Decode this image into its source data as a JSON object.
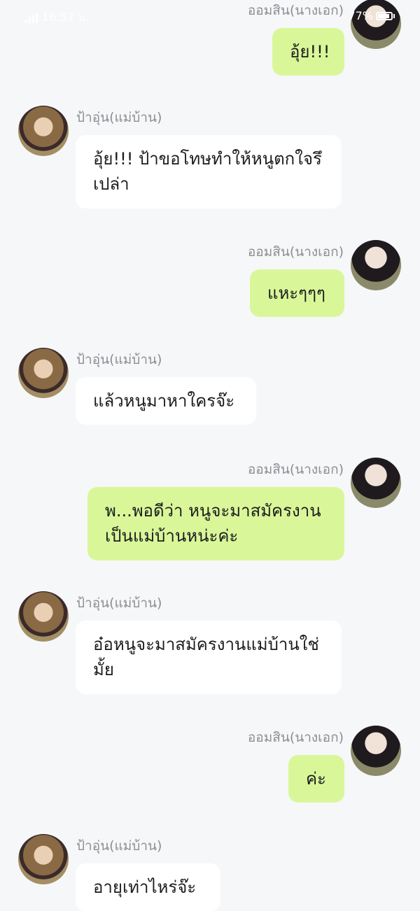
{
  "status_bar": {
    "time": "16:57 น.",
    "battery_percent": "77%"
  },
  "messages": [
    {
      "side": "right",
      "sender": "ออมสิน(นางเอก)",
      "text": "อุ้ย!!!"
    },
    {
      "side": "left",
      "sender": "ป้าอุ่น(แม่บ้าน)",
      "text": "อุ้ย!!! ป้าขอโทษทำให้หนูตกใจรึเปล่า"
    },
    {
      "side": "right",
      "sender": "ออมสิน(นางเอก)",
      "text": "แหะๆๆๆ"
    },
    {
      "side": "left",
      "sender": "ป้าอุ่น(แม่บ้าน)",
      "text": "แล้วหนูมาหาใครจ๊ะ"
    },
    {
      "side": "right",
      "sender": "ออมสิน(นางเอก)",
      "text": "พ...พอดีว่า หนูจะมาสมัครงานเป็นแม่บ้านหน่ะค่ะ"
    },
    {
      "side": "left",
      "sender": "ป้าอุ่น(แม่บ้าน)",
      "text": "อ๋อหนูจะมาสมัครงานแม่บ้านใช่มั้ย"
    },
    {
      "side": "right",
      "sender": "ออมสิน(นางเอก)",
      "text": "ค่ะ"
    },
    {
      "side": "left",
      "sender": "ป้าอุ่น(แม่บ้าน)",
      "text": "อายุเท่าไหร่จ๊ะ"
    }
  ]
}
